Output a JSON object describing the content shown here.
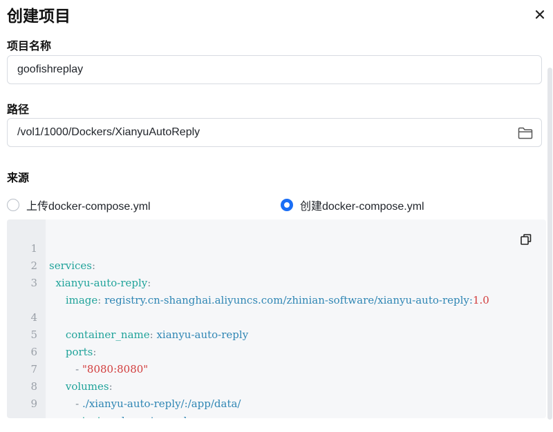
{
  "dialog": {
    "title": "创建项目"
  },
  "form": {
    "name_label_partial": "项目名称",
    "name_value": "goofishreplay",
    "path_label": "路径",
    "path_value": "/vol1/1000/Dockers/XianyuAutoReply",
    "source_label": "来源",
    "source_options": [
      {
        "label": "上传docker-compose.yml",
        "selected": false
      },
      {
        "label": "创建docker-compose.yml",
        "selected": true
      }
    ]
  },
  "editor": {
    "lines": [
      {
        "num": "1",
        "key": "services",
        "colon": ":",
        "value": ""
      },
      {
        "num": "2",
        "indent": "  ",
        "key": "xianyu-auto-reply",
        "colon": ":",
        "value": ""
      },
      {
        "num": "3",
        "indent": "     ",
        "key": "image",
        "colon": ":",
        "value": " registry.cn-shanghai.aliyuncs.com/zhinian-software/xianyu-auto-reply:",
        "value_num": "1.0"
      },
      {
        "num": "4",
        "indent": "     ",
        "key": "container_name",
        "colon": ":",
        "value": " xianyu-auto-reply"
      },
      {
        "num": "5",
        "indent": "     ",
        "key": "ports",
        "colon": ":",
        "value": ""
      },
      {
        "num": "6",
        "indent": "        ",
        "dash": "- ",
        "string": "\"8080:8080\""
      },
      {
        "num": "7",
        "indent": "     ",
        "key": "volumes",
        "colon": ":",
        "value": ""
      },
      {
        "num": "8",
        "indent": "        ",
        "dash": "- ",
        "value": "./xianyu-auto-reply/:/app/data/"
      },
      {
        "num": "9",
        "indent": "     ",
        "key": "restart",
        "colon": ":",
        "value": " unless-stopped"
      }
    ]
  },
  "icons": {
    "close": "close-icon",
    "folder": "folder-icon",
    "copy": "copy-icon"
  },
  "colors": {
    "accent": "#1a6ef5",
    "yaml_key": "#20a39a",
    "yaml_value": "#2f86b4",
    "yaml_number": "#d23c3c"
  }
}
